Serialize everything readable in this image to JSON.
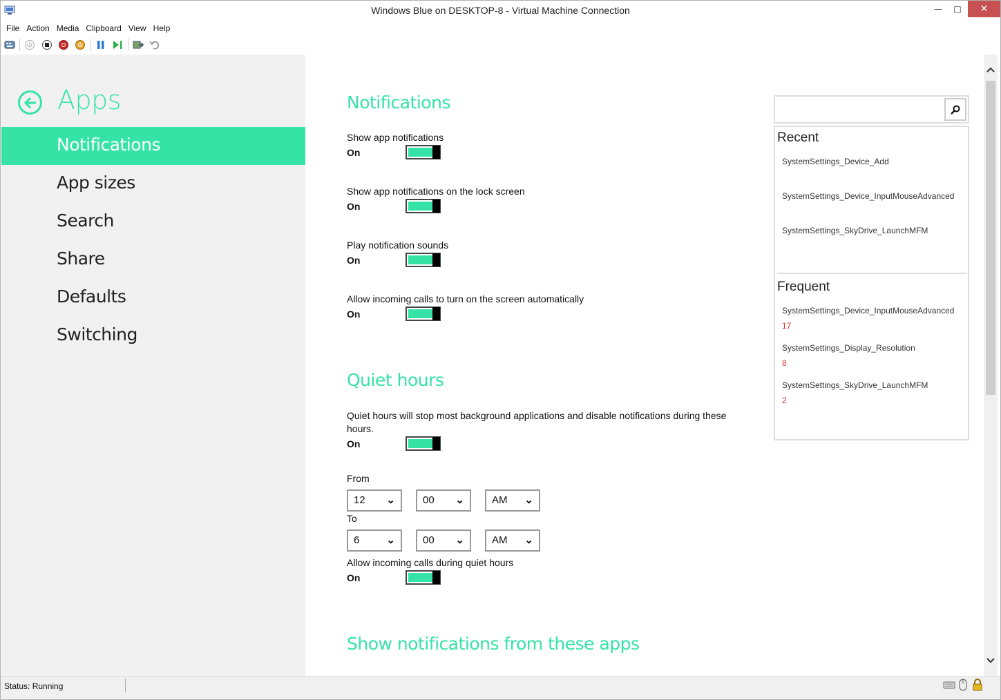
{
  "window": {
    "title": "Windows Blue on DESKTOP-8 - Virtual Machine Connection",
    "minimize": "—",
    "maximize": "□",
    "close": "✕"
  },
  "menu": [
    "File",
    "Action",
    "Media",
    "Clipboard",
    "View",
    "Help"
  ],
  "toolbar": {
    "icons": [
      "ctrl-alt-del-icon",
      "start-icon",
      "turn-off-icon",
      "shutdown-icon",
      "power-icon",
      "pause-icon",
      "resume-icon",
      "checkpoint-icon",
      "revert-icon"
    ]
  },
  "nav": {
    "title": "Apps",
    "items": [
      "Notifications",
      "App sizes",
      "Search",
      "Share",
      "Defaults",
      "Switching"
    ],
    "selected": "Notifications"
  },
  "notifications": {
    "heading": "Notifications",
    "settings": [
      {
        "label": "Show app notifications",
        "state": "On"
      },
      {
        "label": "Show app notifications on the lock screen",
        "state": "On"
      },
      {
        "label": "Play notification sounds",
        "state": "On"
      },
      {
        "label": "Allow incoming calls to turn on the screen automatically",
        "state": "On"
      }
    ]
  },
  "quiet_hours": {
    "heading": "Quiet hours",
    "description": "Quiet hours will stop most background applications and disable notifications during these hours.",
    "state": "On",
    "from_label": "From",
    "from": {
      "hour": "12",
      "minute": "00",
      "ampm": "AM"
    },
    "to_label": "To",
    "to": {
      "hour": "6",
      "minute": "00",
      "ampm": "AM"
    },
    "calls_label": "Allow incoming calls during quiet hours",
    "calls_state": "On"
  },
  "apps_section": {
    "heading": "Show notifications from these apps"
  },
  "side_panel": {
    "search_placeholder": "",
    "recent_label": "Recent",
    "recent": [
      "SystemSettings_Device_Add",
      "SystemSettings_Device_InputMouseAdvanced",
      "SystemSettings_SkyDrive_LaunchMFM"
    ],
    "frequent_label": "Frequent",
    "frequent": [
      {
        "name": "SystemSettings_Device_InputMouseAdvanced",
        "count": "17"
      },
      {
        "name": "SystemSettings_Display_Resolution",
        "count": "8"
      },
      {
        "name": "SystemSettings_SkyDrive_LaunchMFM",
        "count": "2"
      }
    ]
  },
  "status": {
    "text": "Status: Running"
  },
  "colors": {
    "accent": "#35e3a7",
    "nav_bg": "#f1f1f1",
    "count_red": "#dd3333"
  }
}
